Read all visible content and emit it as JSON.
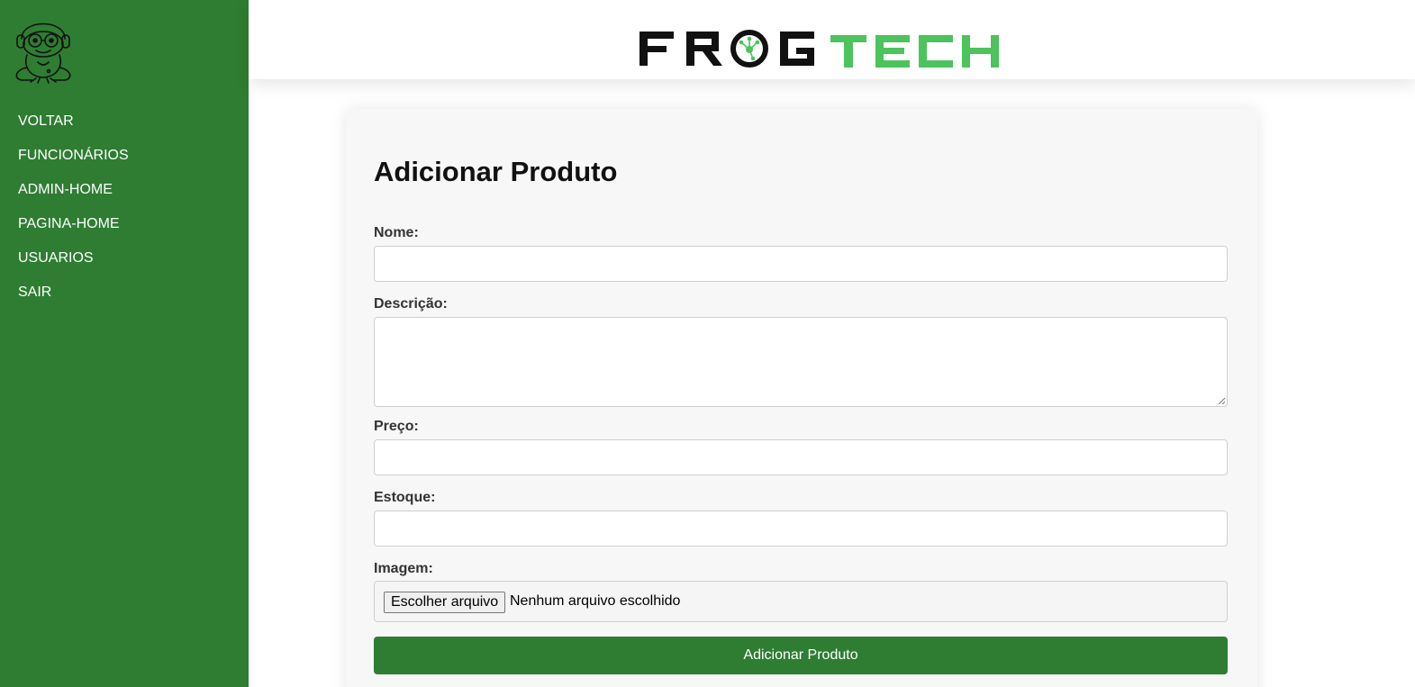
{
  "brand": {
    "logo_left": "FR",
    "logo_mid": "G",
    "logo_right": "TECH",
    "colors": {
      "dark": "#111111",
      "green": "#4cc35c",
      "sidebar": "#2e7d32"
    }
  },
  "sidebar": {
    "logo_icon": "frog-headphones-icon",
    "items": [
      {
        "label": "VOLTAR"
      },
      {
        "label": "FUNCIONÁRIOS"
      },
      {
        "label": "ADMIN-HOME"
      },
      {
        "label": "PAGINA-HOME"
      },
      {
        "label": "USUARIOS"
      },
      {
        "label": "SAIR"
      }
    ]
  },
  "form": {
    "title": "Adicionar Produto",
    "fields": {
      "nome": {
        "label": "Nome:",
        "value": ""
      },
      "descricao": {
        "label": "Descrição:",
        "value": ""
      },
      "preco": {
        "label": "Preço:",
        "value": ""
      },
      "estoque": {
        "label": "Estoque:",
        "value": ""
      },
      "imagem": {
        "label": "Imagem:",
        "button_label": "Escolher arquivo",
        "status": "Nenhum arquivo escolhido"
      }
    },
    "submit_label": "Adicionar Produto"
  }
}
